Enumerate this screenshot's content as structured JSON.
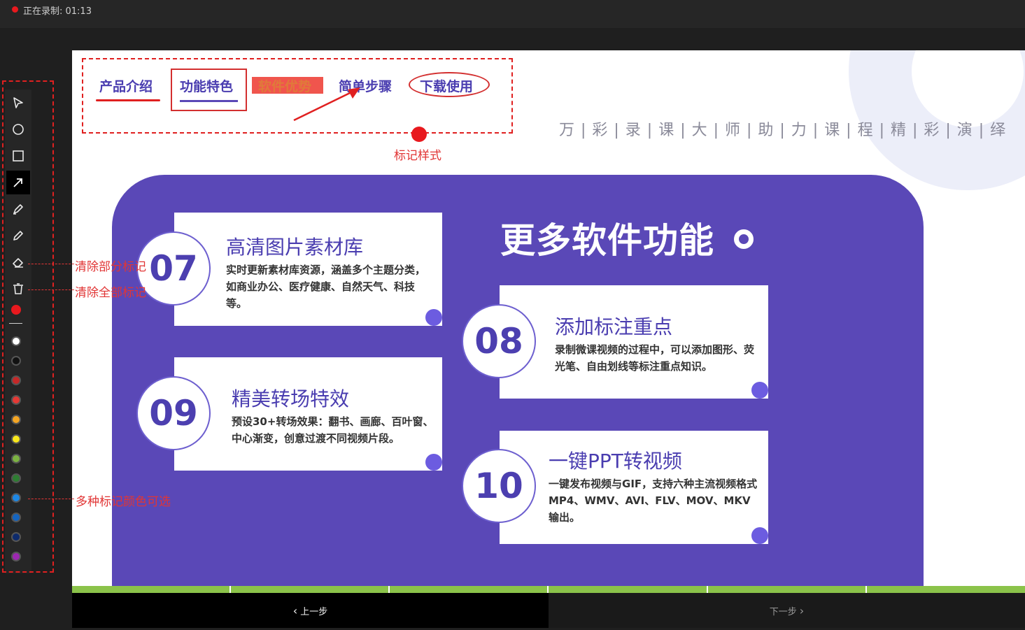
{
  "recording": {
    "label": "正在录制: 01:13"
  },
  "nav": {
    "items": [
      "产品介绍",
      "功能特色",
      "软件优势",
      "简单步骤",
      "下载使用"
    ],
    "marker_label": "标记样式"
  },
  "slide": {
    "tagline": "万 | 彩 | 录 | 课 | 大 | 师 | 助 | 力 | 课 | 程 | 精 | 彩 | 演 | 绎",
    "title": "更多软件功能",
    "cards": [
      {
        "num": "07",
        "title": "高清图片素材库",
        "desc": "实时更新素材库资源，涵盖多个主题分类，如商业办公、医疗健康、自然天气、科技等。"
      },
      {
        "num": "08",
        "title": "添加标注重点",
        "desc": "录制微课视频的过程中，可以添加图形、荧光笔、自由划线等标注重点知识。"
      },
      {
        "num": "09",
        "title": "精美转场特效",
        "desc": "预设30+转场效果：翻书、画廊、百叶窗、中心渐变，创意过渡不同视频片段。"
      },
      {
        "num": "10",
        "title": "一键PPT转视频",
        "desc": "一键发布视频与GIF，支持六种主流视频格式MP4、WMV、AVI、FLV、MOV、MKV输出。"
      }
    ]
  },
  "footer": {
    "prev": "上一步",
    "next": "下一步"
  },
  "toolbar": {
    "tools": [
      "cursor-icon",
      "circle-icon",
      "rectangle-icon",
      "arrow-icon",
      "highlighter-icon",
      "pen-icon",
      "eraser-icon",
      "trash-icon"
    ],
    "colors": [
      "#ffffff",
      "#111111",
      "#c62828",
      "#e53935",
      "#f5a623",
      "#f8e71c",
      "#7cb342",
      "#2e7d32",
      "#1e88e5",
      "#1565c0",
      "#0d2a6b",
      "#9c27b0"
    ]
  },
  "annotations": {
    "clear_partial": "清除部分标记",
    "clear_all": "清除全部标记",
    "colors": "多种标记颜色可选"
  }
}
